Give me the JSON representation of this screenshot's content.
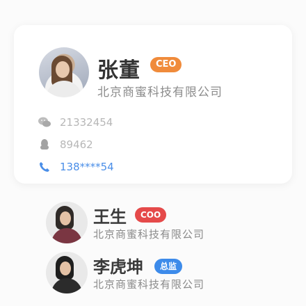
{
  "main_contact": {
    "name": "张董",
    "role_badge": "CEO",
    "company": "北京商蜜科技有限公司",
    "wechat": "21332454",
    "qq": "89462",
    "phone": "138****54"
  },
  "contacts": [
    {
      "name": "王生",
      "role_badge": "COO",
      "company": "北京商蜜科技有限公司"
    },
    {
      "name": "李虎坤",
      "role_badge": "总监",
      "company": "北京商蜜科技有限公司"
    }
  ],
  "colors": {
    "ceo_badge": "#f08b3b",
    "coo_badge": "#e54a4a",
    "director_badge": "#3d8bea",
    "phone_accent": "#4a8ee8"
  },
  "icons": {
    "wechat": "wechat-icon",
    "qq": "qq-icon",
    "phone": "phone-icon"
  }
}
